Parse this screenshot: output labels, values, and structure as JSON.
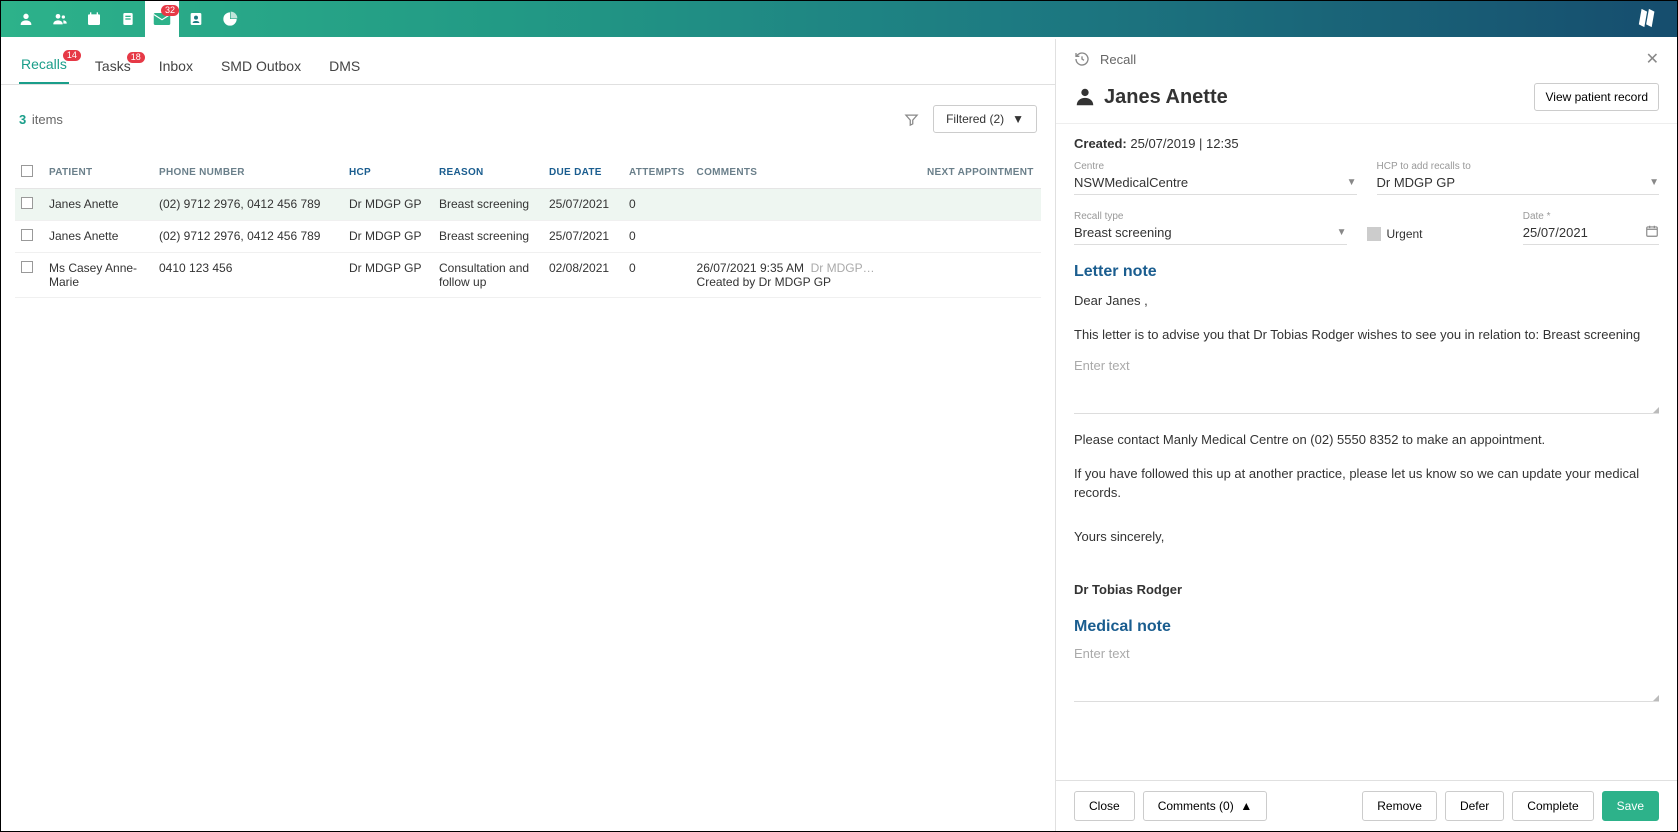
{
  "topbar": {
    "mail_badge": "32"
  },
  "tabs": {
    "recalls": "Recalls",
    "recalls_badge": "14",
    "tasks": "Tasks",
    "tasks_badge": "18",
    "inbox": "Inbox",
    "smd": "SMD Outbox",
    "dms": "DMS"
  },
  "list": {
    "count": "3",
    "items_label": "items",
    "filter_label": "Filtered (2)"
  },
  "columns": {
    "patient": "PATIENT",
    "phone": "PHONE NUMBER",
    "hcp": "HCP",
    "reason": "REASON",
    "due": "DUE DATE",
    "attempts": "ATTEMPTS",
    "comments": "COMMENTS",
    "next": "NEXT APPOINTMENT"
  },
  "rows": [
    {
      "patient": "Janes Anette",
      "phone": "(02) 9712 2976, 0412 456 789",
      "hcp": "Dr MDGP GP",
      "reason": "Breast screening",
      "due": "25/07/2021",
      "attempts": "0",
      "comment_time": "",
      "comment_hcp": "",
      "comment_text": "",
      "next": ""
    },
    {
      "patient": "Janes Anette",
      "phone": "(02) 9712 2976, 0412 456 789",
      "hcp": "Dr MDGP GP",
      "reason": "Breast screening",
      "due": "25/07/2021",
      "attempts": "0",
      "comment_time": "",
      "comment_hcp": "",
      "comment_text": "",
      "next": ""
    },
    {
      "patient": "Ms Casey Anne-Marie",
      "phone": "0410 123 456",
      "hcp": "Dr MDGP GP",
      "reason": "Consultation and follow up",
      "due": "02/08/2021",
      "attempts": "0",
      "comment_time": "26/07/2021 9:35 AM",
      "comment_hcp": "Dr MDGP…",
      "comment_text": "Created by Dr MDGP GP",
      "next": ""
    }
  ],
  "panel": {
    "title": "Recall",
    "patient_name": "Janes Anette",
    "view_record": "View patient record",
    "created_label": "Created:",
    "created_value": "25/07/2019 | 12:35",
    "centre_label": "Centre",
    "centre_value": "NSWMedicalCentre",
    "hcp_label": "HCP to add recalls to",
    "hcp_value": "Dr MDGP GP",
    "recall_type_label": "Recall type",
    "recall_type_value": "Breast screening",
    "urgent_label": "Urgent",
    "date_label": "Date *",
    "date_value": "25/07/2021",
    "letter_title": "Letter note",
    "letter_greeting": "Dear Janes ,",
    "letter_line1": "This letter is to advise you that Dr Tobias Rodger wishes to see you in relation to: Breast screening",
    "enter_text": "Enter text",
    "letter_line2": "Please contact Manly Medical Centre on (02) 5550 8352 to make an appointment.",
    "letter_line3": "If you have followed this up at another practice, please let us know so we can update your medical records.",
    "letter_signoff": "Yours sincerely,",
    "letter_signer": "Dr Tobias Rodger",
    "medical_title": "Medical note"
  },
  "footer": {
    "close": "Close",
    "comments": "Comments (0)",
    "remove": "Remove",
    "defer": "Defer",
    "complete": "Complete",
    "save": "Save"
  }
}
